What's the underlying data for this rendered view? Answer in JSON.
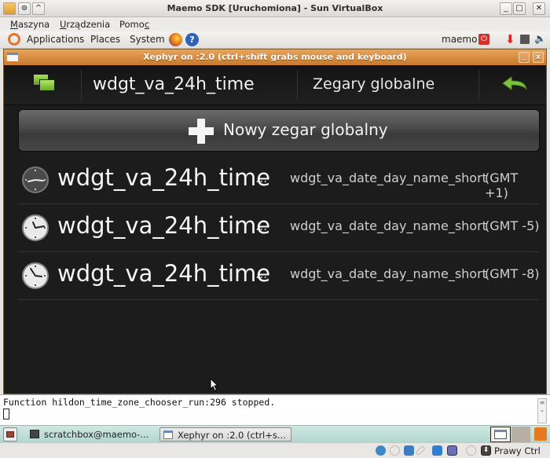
{
  "vbox": {
    "title": "Maemo SDK [Uruchomiona] - Sun VirtualBox",
    "menu": [
      "Maszyna",
      "Urządzenia",
      "Pomoc"
    ],
    "window_buttons": {
      "minimize": "_",
      "maximize": "□",
      "close": "✕"
    }
  },
  "panel": {
    "applications": "Applications",
    "places": "Places",
    "system": "System",
    "user": "maemo"
  },
  "xephyr": {
    "title": "Xephyr on :2.0 (ctrl+shift grabs mouse and keyboard)",
    "buttons": {
      "minimize": "_",
      "close": "x"
    }
  },
  "app": {
    "title": "wdgt_va_24h_time",
    "subtitle": "Zegary globalne",
    "new_clock_label": "Nowy zegar globalny",
    "clocks": [
      {
        "time": "wdgt_va_24h_time",
        "ellipsis": "...",
        "day": "wdgt_va_date_day_name_short",
        "gmt": "(GMT +1)",
        "theme": "dark"
      },
      {
        "time": "wdgt_va_24h_time",
        "ellipsis": "...",
        "day": "wdgt_va_date_day_name_short",
        "gmt": "(GMT -5)",
        "theme": "light"
      },
      {
        "time": "wdgt_va_24h_time",
        "ellipsis": "...",
        "day": "wdgt_va_date_day_name_short",
        "gmt": "(GMT -8)",
        "theme": "light"
      }
    ]
  },
  "terminal": {
    "output": "Function hildon_time_zone_chooser_run:296 stopped."
  },
  "taskbar": {
    "tasks": [
      {
        "label": "scratchbox@maemo-..."
      },
      {
        "label": "Xephyr on :2.0 (ctrl+s..."
      }
    ]
  },
  "statusbar": {
    "host_key": "Prawy Ctrl"
  },
  "colors": {
    "accent_green": "#7cc242",
    "xephyr_title": "#d98a3e",
    "app_bg": "#1c1c1c"
  }
}
